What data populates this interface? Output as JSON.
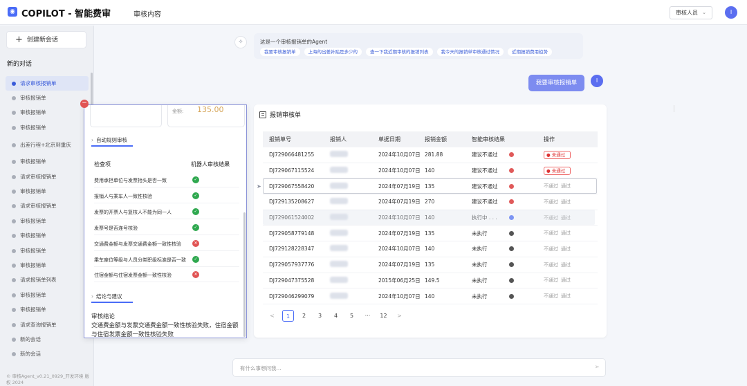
{
  "header": {
    "logo_glyph": "◉",
    "brand": "COPILOT - 智能费审",
    "nav": "审核内容",
    "role": "审核人员",
    "avatar": "I"
  },
  "sidebar": {
    "new_chat": "创建新会话",
    "section_title": "新的对话",
    "items": [
      {
        "label": "请求审核报销单",
        "active": true
      },
      {
        "label": "审核报销单"
      },
      {
        "label": "审核报销单"
      },
      {
        "label": "审核报销单"
      },
      {
        "label": "出差行程+北京到重庆",
        "tall": true
      },
      {
        "label": "审核报销单"
      },
      {
        "label": "请求审核报销单"
      },
      {
        "label": "审核报销单"
      },
      {
        "label": "请求审核报销单"
      },
      {
        "label": "审核报销单"
      },
      {
        "label": "审核报销单"
      },
      {
        "label": "审核报销单"
      },
      {
        "label": "审核报销单"
      },
      {
        "label": "请求报销单列表"
      },
      {
        "label": "审核报销单"
      },
      {
        "label": "审核报销单"
      },
      {
        "label": "请求查询报销单"
      },
      {
        "label": "新的会话"
      },
      {
        "label": "新的会话"
      }
    ],
    "footer": "© 审核Agent_v0.21_0929_开发环境 版权 2024"
  },
  "agent": {
    "intro": "这是一个审核报销单的Agent",
    "chips": [
      "我要审核报销单",
      "上海的出差补贴是多少的",
      "查一下我近期审核的报销列表",
      "我今天的报销单审核通过情况",
      "近期报销费用趋势"
    ]
  },
  "user_message": {
    "text": "我要审核报销单",
    "avatar": "I"
  },
  "table_panel": {
    "title": "报销审核单",
    "columns": [
      "报销单号",
      "报销人",
      "单据日期",
      "报销金额",
      "智能审核结果",
      "操作"
    ],
    "rows": [
      {
        "id": "DJ729066481255",
        "date": "2024年10月07日",
        "amount": "281.88",
        "result": "建议不通过",
        "dot": "red",
        "ops": [
          "未通过"
        ],
        "ops_type": "chip"
      },
      {
        "id": "DJ729067115524",
        "date": "2024年10月07日",
        "amount": "140",
        "result": "建议不通过",
        "dot": "red",
        "ops": [
          "未通过"
        ],
        "ops_type": "chip"
      },
      {
        "id": "DJ729067558420",
        "date": "2024年07月19日",
        "amount": "135",
        "result": "建议不通过",
        "dot": "red",
        "ops": [
          "不通过",
          "通过"
        ],
        "ops_type": "text"
      },
      {
        "id": "DJ729135208627",
        "date": "2024年07月19日",
        "amount": "270",
        "result": "建议不通过",
        "dot": "red",
        "ops": [
          "不通过",
          "通过"
        ],
        "ops_type": "text"
      },
      {
        "id": "DJ729061524002",
        "date": "2024年10月07日",
        "amount": "140",
        "result": "执行中 . . .",
        "dot": "blue",
        "ops": [
          "不通过",
          "通过"
        ],
        "ops_type": "text"
      },
      {
        "id": "DJ729058779148",
        "date": "2024年07月19日",
        "amount": "135",
        "result": "未执行",
        "dot": "black",
        "ops": [
          "不通过",
          "通过"
        ],
        "ops_type": "text"
      },
      {
        "id": "DJ729128228347",
        "date": "2024年10月07日",
        "amount": "140",
        "result": "未执行",
        "dot": "black",
        "ops": [
          "不通过",
          "通过"
        ],
        "ops_type": "text"
      },
      {
        "id": "DJ729057937776",
        "date": "2024年07月19日",
        "amount": "135",
        "result": "未执行",
        "dot": "black",
        "ops": [
          "不通过",
          "通过"
        ],
        "ops_type": "text"
      },
      {
        "id": "DJ729047375528",
        "date": "2015年06月25日",
        "amount": "149.5",
        "result": "未执行",
        "dot": "black",
        "ops": [
          "不通过",
          "通过"
        ],
        "ops_type": "text"
      },
      {
        "id": "DJ729046299079",
        "date": "2024年10月07日",
        "amount": "140",
        "result": "未执行",
        "dot": "black",
        "ops": [
          "不通过",
          "通过"
        ],
        "ops_type": "text"
      }
    ],
    "pagination": {
      "prev": "<",
      "pages": [
        "1",
        "2",
        "3",
        "4",
        "5",
        "···",
        "12"
      ],
      "current": "1",
      "next": ">"
    }
  },
  "popup": {
    "amount_label": "金额:",
    "amount_value": "135.00",
    "rules_section": "自动规则审核",
    "col_item": "检查项",
    "col_result": "机器人审核结果",
    "checks": [
      {
        "item": "费用承担单位与发票抬头是否一致",
        "ok": true
      },
      {
        "item": "报销人与乘车人一致性核验",
        "ok": true
      },
      {
        "item": "发票的开票人与复核人不能为同一人",
        "ok": true
      },
      {
        "item": "发票号是否连号核验",
        "ok": true
      },
      {
        "item": "交通费金额与发票交通费金额一致性核验",
        "ok": false
      },
      {
        "item": "乘车座位等级与人员分类职级标准是否一致",
        "ok": true
      },
      {
        "item": "住宿金额与住宿发票金额一致性核验",
        "ok": false
      }
    ],
    "conclusion_section": "结论与建议",
    "conclusion_title": "审核结论",
    "conclusion_text": "交通费金额与发票交通费金额一致性核验失败，住宿金额与住宿发票金额一致性核验失败"
  },
  "input": {
    "placeholder": "有什么事想问我..."
  }
}
